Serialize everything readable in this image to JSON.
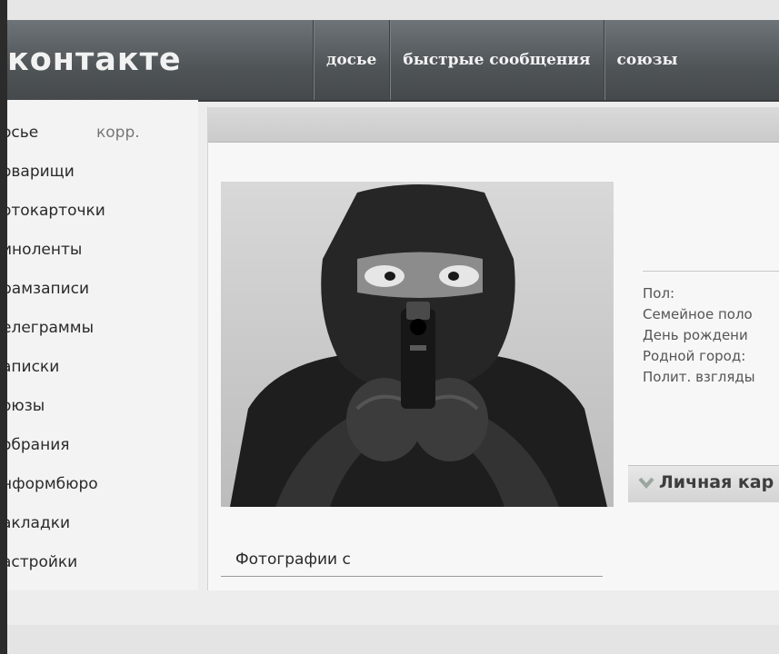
{
  "header": {
    "logo": "контакте",
    "nav": [
      "досье",
      "быстрые сообщения",
      "союзы"
    ]
  },
  "sidebar": {
    "badge": "корр.",
    "items": [
      {
        "label": "осье"
      },
      {
        "label": "оварищи"
      },
      {
        "label": "отокарточки"
      },
      {
        "label": "инолeнты"
      },
      {
        "label": "рамзаписи"
      },
      {
        "label": "елеграммы"
      },
      {
        "label": "аписки"
      },
      {
        "label": "оюзы"
      },
      {
        "label": "обрания"
      },
      {
        "label": "нформбюро"
      },
      {
        "label": "акладки"
      },
      {
        "label": "астройки"
      }
    ]
  },
  "profile": {
    "photo_caption": "Фотографии с",
    "info_fields": [
      "Пол:",
      "Семейное поло",
      "День рождени",
      "Родной город:",
      "Полит. взгляды"
    ],
    "card_label": "Личная кар"
  },
  "colors": {
    "header": "#4f5457",
    "page_bg": "#ededed",
    "sidebar_text": "#2a2a2a"
  }
}
